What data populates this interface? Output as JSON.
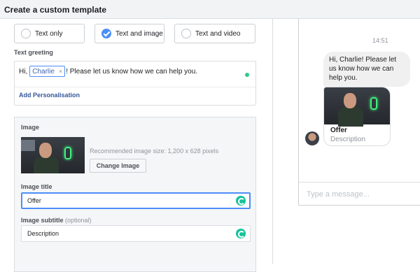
{
  "header": {
    "title": "Create a custom template"
  },
  "template_types": {
    "options": [
      {
        "label": "Text only",
        "checked": false
      },
      {
        "label": "Text and image",
        "checked": true
      },
      {
        "label": "Text and video",
        "checked": false
      }
    ]
  },
  "greeting": {
    "label": "Text greeting",
    "prefix": "Hi,",
    "chip": "Charlie",
    "chip_remove": "×",
    "suffix": "! Please let us know how we can help you.",
    "add_personalisation": "Add Personalisation"
  },
  "image_section": {
    "label": "Image",
    "recommended": "Recommended image size: 1,200 x 628 pixels",
    "change_button": "Change Image",
    "title_label": "Image title",
    "title_value": "Offer",
    "subtitle_label": "Image subtitle",
    "subtitle_optional": "(optional)",
    "subtitle_value": "Description"
  },
  "preview": {
    "time": "14:51",
    "message": "Hi, Charlie! Please let us know how we can help you.",
    "card_title": "Offer",
    "card_subtitle": "Description",
    "compose_placeholder": "Type a message..."
  },
  "colors": {
    "accent": "#4c8ef7",
    "link": "#365899",
    "grammarly": "#15c39a",
    "status_dot": "#2ccc8a"
  }
}
